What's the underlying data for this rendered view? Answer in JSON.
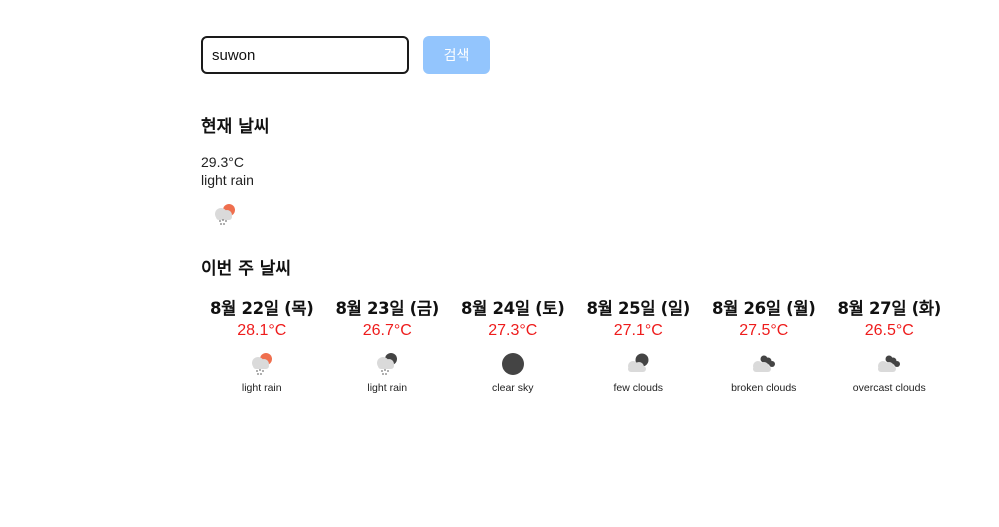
{
  "search": {
    "value": "suwon",
    "button_label": "검색"
  },
  "current": {
    "title": "현재 날씨",
    "temp": "29.3°C",
    "desc": "light rain",
    "icon": "light-rain-day-icon"
  },
  "weekly": {
    "title": "이번 주 날씨",
    "days": [
      {
        "date": "8월 22일 (목)",
        "temp": "28.1°C",
        "desc": "light rain",
        "icon": "light-rain-day-icon"
      },
      {
        "date": "8월 23일 (금)",
        "temp": "26.7°C",
        "desc": "light rain",
        "icon": "light-rain-night-icon"
      },
      {
        "date": "8월 24일 (토)",
        "temp": "27.3°C",
        "desc": "clear sky",
        "icon": "clear-night-icon"
      },
      {
        "date": "8월 25일 (일)",
        "temp": "27.1°C",
        "desc": "few clouds",
        "icon": "few-clouds-night-icon"
      },
      {
        "date": "8월 26일 (월)",
        "temp": "27.5°C",
        "desc": "broken clouds",
        "icon": "broken-clouds-icon"
      },
      {
        "date": "8월 27일 (화)",
        "temp": "26.5°C",
        "desc": "overcast clouds",
        "icon": "overcast-clouds-icon"
      }
    ]
  },
  "colors": {
    "temp": "#ee1c1c",
    "button": "#93c5fd",
    "sun": "#ef6f4e",
    "moon": "#444444",
    "cloud": "#dadada"
  }
}
